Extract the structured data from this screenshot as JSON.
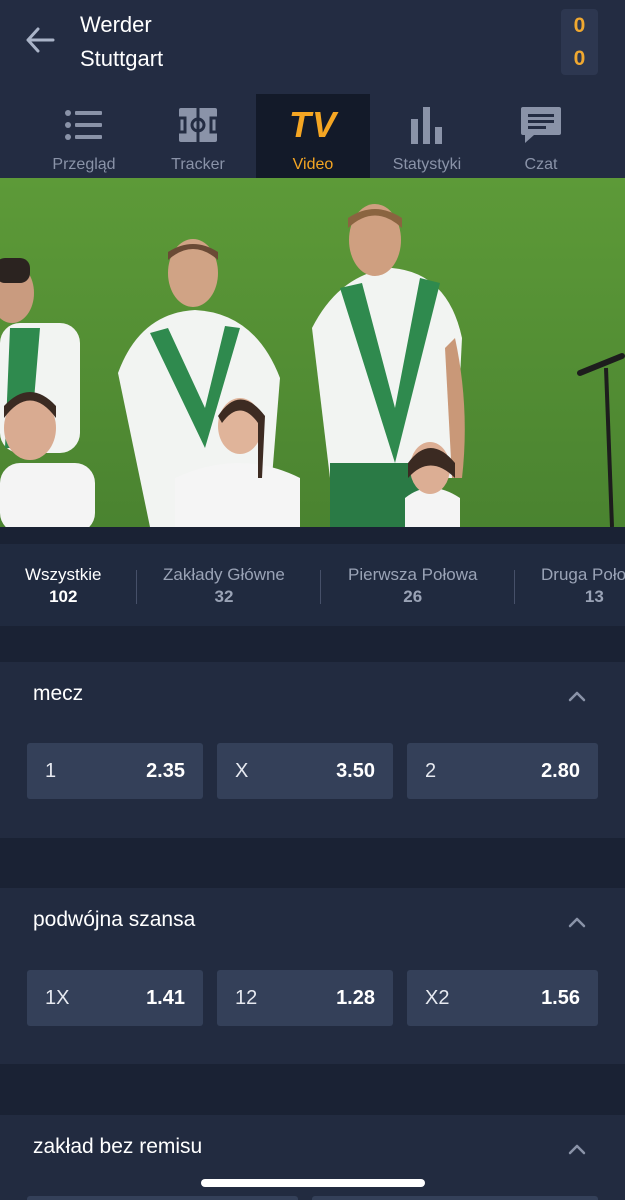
{
  "header": {
    "home_team": "Werder",
    "away_team": "Stuttgart",
    "home_score": "0",
    "away_score": "0",
    "back_icon": "arrow-left-icon"
  },
  "tabs": [
    {
      "label": "Przegląd",
      "icon": "list-icon",
      "active": false
    },
    {
      "label": "Tracker",
      "icon": "pitch-icon",
      "active": false
    },
    {
      "label": "Video",
      "icon": "tv-icon",
      "glyph": "TV",
      "active": true
    },
    {
      "label": "Statystyki",
      "icon": "bar-chart-icon",
      "active": false
    },
    {
      "label": "Czat",
      "icon": "chat-icon",
      "active": false
    }
  ],
  "filters": [
    {
      "label": "Wszystkie",
      "count": "102",
      "active": true
    },
    {
      "label": "Zakłady Główne",
      "count": "32",
      "active": false
    },
    {
      "label": "Pierwsza Połowa",
      "count": "26",
      "active": false
    },
    {
      "label": "Druga Połowa",
      "count": "13",
      "active": false
    }
  ],
  "markets": [
    {
      "title": "mecz",
      "odds": [
        {
          "label": "1",
          "value": "2.35"
        },
        {
          "label": "X",
          "value": "3.50"
        },
        {
          "label": "2",
          "value": "2.80"
        }
      ]
    },
    {
      "title": "podwójna szansa",
      "odds": [
        {
          "label": "1X",
          "value": "1.41"
        },
        {
          "label": "12",
          "value": "1.28"
        },
        {
          "label": "X2",
          "value": "1.56"
        }
      ]
    },
    {
      "title": "zakład bez remisu",
      "odds": []
    }
  ],
  "colors": {
    "accent": "#f5a623",
    "background": "#1a2234",
    "panel": "#222b40",
    "button": "#344059"
  }
}
